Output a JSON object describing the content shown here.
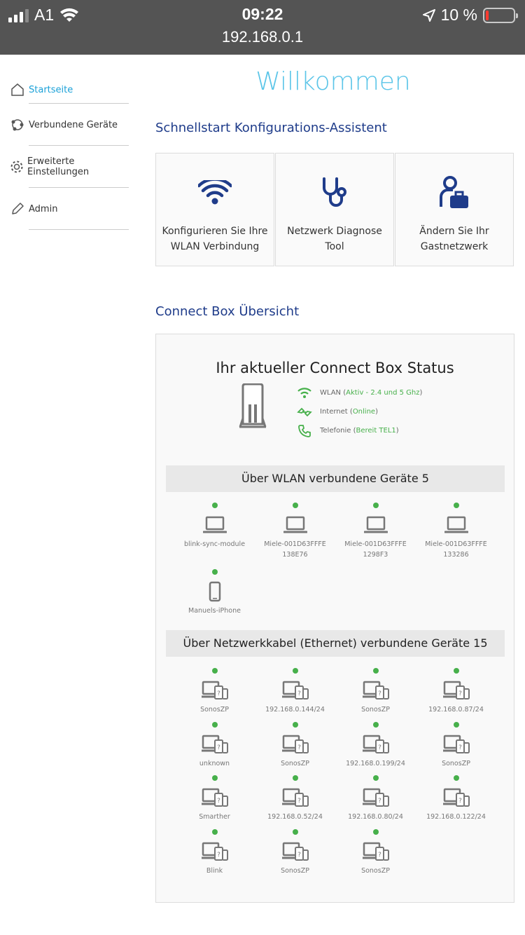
{
  "status_bar": {
    "carrier": "A1",
    "time": "09:22",
    "url": "192.168.0.1",
    "battery": "10 %"
  },
  "sidebar": {
    "items": [
      {
        "label": "Startseite",
        "icon": "home-icon",
        "active": true
      },
      {
        "label": "Verbundene Geräte",
        "icon": "devices-icon",
        "active": false
      },
      {
        "label": "Erweiterte Einstellungen",
        "icon": "gear-icon",
        "active": false
      },
      {
        "label": "Admin",
        "icon": "pencil-icon",
        "active": false
      }
    ]
  },
  "main": {
    "welcome": "Willkommen",
    "quickstart_title": "Schnellstart Konfigurations-Assistent",
    "cards": [
      {
        "line1": "Konfigurieren Sie Ihre",
        "line2": "WLAN Verbindung",
        "icon": "wifi-icon"
      },
      {
        "line1": "Netzwerk Diagnose",
        "line2": "Tool",
        "icon": "stethoscope-icon"
      },
      {
        "line1": "Ändern Sie Ihr",
        "line2": "Gastnetzwerk",
        "icon": "guest-network-icon"
      }
    ],
    "overview_title": "Connect Box Übersicht",
    "status_heading": "Ihr aktueller Connect Box Status",
    "status": [
      {
        "label": "WLAN",
        "value": "Aktiv - 2.4 und 5 Ghz",
        "icon": "wifi-icon"
      },
      {
        "label": "Internet",
        "value": "Online",
        "icon": "internet-icon"
      },
      {
        "label": "Telefonie",
        "value": "Bereit TEL1",
        "icon": "phone-icon"
      }
    ],
    "wlan_band": "Über WLAN verbundene Geräte 5",
    "wlan_devices": [
      {
        "line1": "blink-sync-module",
        "line2": "",
        "type": "laptop"
      },
      {
        "line1": "Miele-001D63FFFE",
        "line2": "138E76",
        "type": "laptop"
      },
      {
        "line1": "Miele-001D63FFFE",
        "line2": "1298F3",
        "type": "laptop"
      },
      {
        "line1": "Miele-001D63FFFE",
        "line2": "133286",
        "type": "laptop"
      },
      {
        "line1": "Manuels-iPhone",
        "line2": "",
        "type": "phone"
      }
    ],
    "eth_band": "Über Netzwerkkabel (Ethernet) verbundene Geräte 15",
    "eth_devices": [
      "SonosZP",
      "192.168.0.144/24",
      "SonosZP",
      "192.168.0.87/24",
      "unknown",
      "SonosZP",
      "192.168.0.199/24",
      "SonosZP",
      "Smarther",
      "192.168.0.52/24",
      "192.168.0.80/24",
      "192.168.0.122/24",
      "Blink",
      "SonosZP",
      "SonosZP"
    ]
  },
  "colors": {
    "accent_blue": "#1f3c8a",
    "welcome_cyan": "#5bc5e8",
    "active_nav": "#1ba1d8",
    "status_green": "#47b04b"
  }
}
